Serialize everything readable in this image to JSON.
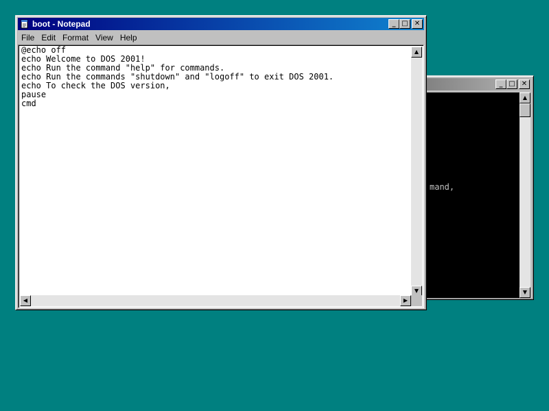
{
  "notepad": {
    "title": "boot - Notepad",
    "menu": [
      "File",
      "Edit",
      "Format",
      "View",
      "Help"
    ],
    "content": "@echo off\necho Welcome to DOS 2001!\necho Run the command \"help\" for commands.\necho Run the commands \"shutdown\" and \"logoff\" to exit DOS 2001.\necho To check the DOS version,\npause\ncmd",
    "buttons": {
      "minimize": "_",
      "maximize": "□",
      "close": "✕"
    },
    "icon": "notepad-icon"
  },
  "console": {
    "visible_text": "mand,",
    "buttons": {
      "minimize": "_",
      "maximize": "□",
      "close": "✕"
    }
  },
  "scroll_arrows": {
    "up": "▲",
    "down": "▼",
    "left": "◀",
    "right": "▶"
  },
  "colors": {
    "desktop": "#008080",
    "active_title": "#000080",
    "inactive_title": "#808080"
  }
}
